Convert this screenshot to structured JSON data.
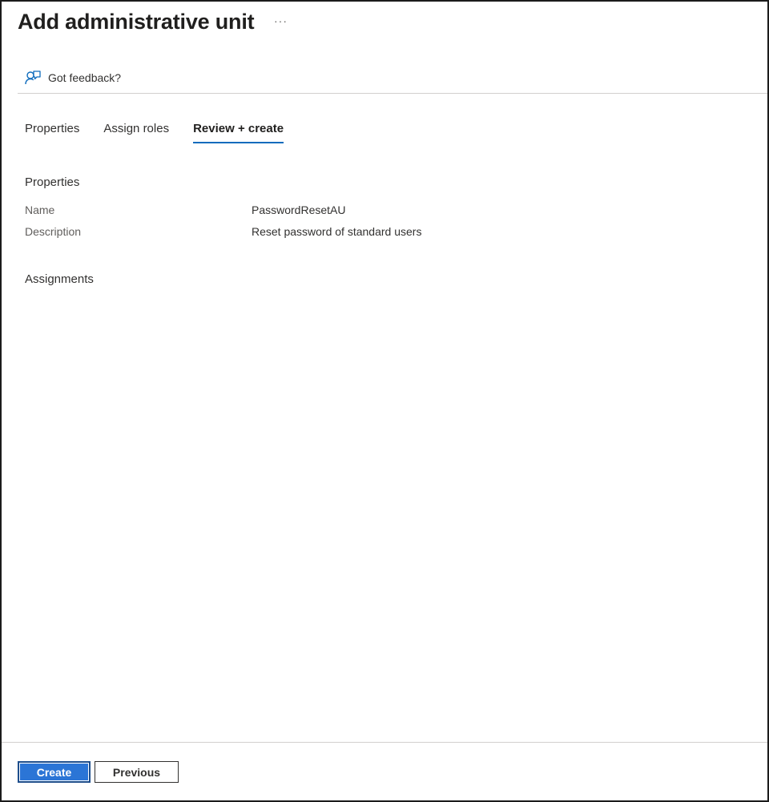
{
  "header": {
    "title": "Add administrative unit",
    "more_label": "···"
  },
  "feedback": {
    "label": "Got feedback?",
    "icon": "feedback-person-icon"
  },
  "tabs": [
    {
      "label": "Properties",
      "active": false
    },
    {
      "label": "Assign roles",
      "active": false
    },
    {
      "label": "Review + create",
      "active": true
    }
  ],
  "properties": {
    "section_title": "Properties",
    "fields": [
      {
        "label": "Name",
        "value": "PasswordResetAU"
      },
      {
        "label": "Description",
        "value": "Reset password of standard users"
      }
    ]
  },
  "assignments": {
    "section_title": "Assignments"
  },
  "footer": {
    "create_label": "Create",
    "previous_label": "Previous"
  },
  "colors": {
    "accent": "#0f6cbd",
    "primary_button": "#2b75d6",
    "text": "#323130",
    "muted_text": "#605e5c",
    "divider": "#d2d0ce"
  }
}
